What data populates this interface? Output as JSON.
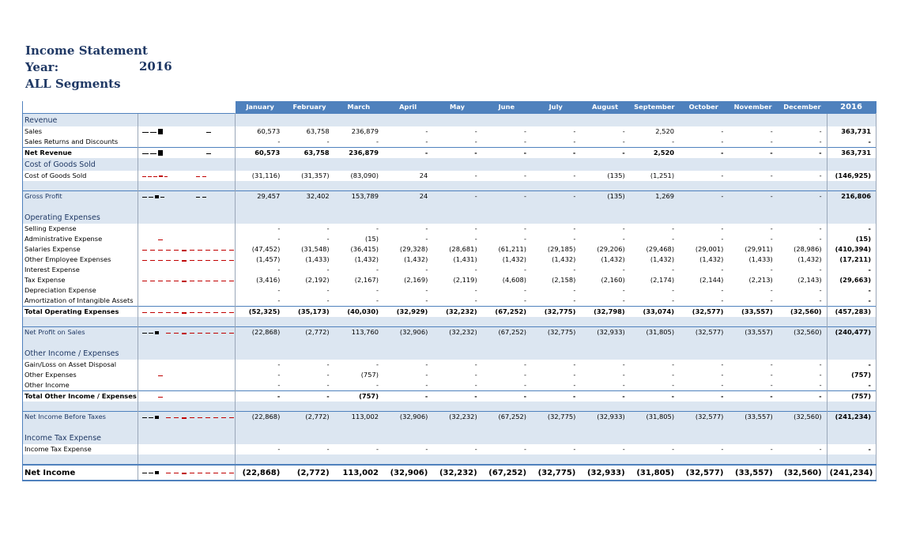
{
  "header": {
    "title": "Income Statement",
    "year_label": "Year:",
    "year_value": "2016",
    "segment": "ALL Segments"
  },
  "columns": [
    "January",
    "February",
    "March",
    "April",
    "May",
    "June",
    "July",
    "August",
    "September",
    "October",
    "November",
    "December",
    "2016"
  ],
  "rows": [
    {
      "type": "section",
      "label": "Revenue",
      "first": true
    },
    {
      "type": "line",
      "label": "Sales",
      "spark": "black",
      "values": [
        "60,573",
        "63,758",
        "236,879",
        "-",
        "-",
        "-",
        "-",
        "-",
        "2,520",
        "-",
        "-",
        "-",
        "363,731"
      ]
    },
    {
      "type": "line",
      "label": "Sales Returns and Discounts",
      "values": [
        "-",
        "-",
        "-",
        "-",
        "-",
        "-",
        "-",
        "-",
        "-",
        "-",
        "-",
        "-",
        "-"
      ]
    },
    {
      "type": "total",
      "label": "Net Revenue",
      "spark": "black",
      "values": [
        "60,573",
        "63,758",
        "236,879",
        "-",
        "-",
        "-",
        "-",
        "-",
        "2,520",
        "-",
        "-",
        "-",
        "363,731"
      ]
    },
    {
      "type": "section",
      "label": "Cost of Goods Sold"
    },
    {
      "type": "line",
      "label": "Cost of Goods Sold",
      "spark": "red",
      "values": [
        "(31,116)",
        "(31,357)",
        "(83,090)",
        "24",
        "-",
        "-",
        "-",
        "(135)",
        "(1,251)",
        "-",
        "-",
        "-",
        "(146,925)"
      ]
    },
    {
      "type": "spacer"
    },
    {
      "type": "shaded",
      "label": "Gross Profit",
      "spark": "mixed",
      "values": [
        "29,457",
        "32,402",
        "153,789",
        "24",
        "-",
        "-",
        "-",
        "(135)",
        "1,269",
        "-",
        "-",
        "-",
        "216,806"
      ]
    },
    {
      "type": "spacer"
    },
    {
      "type": "section",
      "label": "Operating Expenses"
    },
    {
      "type": "line",
      "label": "Selling Expense",
      "values": [
        "-",
        "-",
        "-",
        "-",
        "-",
        "-",
        "-",
        "-",
        "-",
        "-",
        "-",
        "-",
        "-"
      ]
    },
    {
      "type": "line",
      "label": "Administrative Expense",
      "spark": "reddot",
      "values": [
        "-",
        "-",
        "(15)",
        "-",
        "-",
        "-",
        "-",
        "-",
        "-",
        "-",
        "-",
        "-",
        "(15)"
      ]
    },
    {
      "type": "line",
      "label": "Salaries Expense",
      "spark": "redline",
      "values": [
        "(47,452)",
        "(31,548)",
        "(36,415)",
        "(29,328)",
        "(28,681)",
        "(61,211)",
        "(29,185)",
        "(29,206)",
        "(29,468)",
        "(29,001)",
        "(29,911)",
        "(28,986)",
        "(410,394)"
      ]
    },
    {
      "type": "line",
      "label": "Other Employee Expenses",
      "spark": "redline",
      "values": [
        "(1,457)",
        "(1,433)",
        "(1,432)",
        "(1,432)",
        "(1,431)",
        "(1,432)",
        "(1,432)",
        "(1,432)",
        "(1,432)",
        "(1,432)",
        "(1,433)",
        "(1,432)",
        "(17,211)"
      ]
    },
    {
      "type": "line",
      "label": "Interest Expense",
      "values": [
        "-",
        "-",
        "-",
        "-",
        "-",
        "-",
        "-",
        "-",
        "-",
        "-",
        "-",
        "-",
        "-"
      ]
    },
    {
      "type": "line",
      "label": "Tax Expense",
      "spark": "redline",
      "values": [
        "(3,416)",
        "(2,192)",
        "(2,167)",
        "(2,169)",
        "(2,119)",
        "(4,608)",
        "(2,158)",
        "(2,160)",
        "(2,174)",
        "(2,144)",
        "(2,213)",
        "(2,143)",
        "(29,663)"
      ]
    },
    {
      "type": "line",
      "label": "Depreciation Expense",
      "values": [
        "-",
        "-",
        "-",
        "-",
        "-",
        "-",
        "-",
        "-",
        "-",
        "-",
        "-",
        "-",
        "-"
      ]
    },
    {
      "type": "line",
      "label": "Amortization of Intangible Assets",
      "values": [
        "-",
        "-",
        "-",
        "-",
        "-",
        "-",
        "-",
        "-",
        "-",
        "-",
        "-",
        "-",
        "-"
      ]
    },
    {
      "type": "total",
      "label": "Total Operating Expenses",
      "spark": "redline",
      "values": [
        "(52,325)",
        "(35,173)",
        "(40,030)",
        "(32,929)",
        "(32,232)",
        "(67,252)",
        "(32,775)",
        "(32,798)",
        "(33,074)",
        "(32,577)",
        "(33,557)",
        "(32,560)",
        "(457,283)"
      ]
    },
    {
      "type": "spacer"
    },
    {
      "type": "shaded",
      "label": "Net Profit on Sales",
      "spark": "mixedline",
      "values": [
        "(22,868)",
        "(2,772)",
        "113,760",
        "(32,906)",
        "(32,232)",
        "(67,252)",
        "(32,775)",
        "(32,933)",
        "(31,805)",
        "(32,577)",
        "(33,557)",
        "(32,560)",
        "(240,477)"
      ]
    },
    {
      "type": "spacer"
    },
    {
      "type": "section",
      "label": "Other Income /  Expenses"
    },
    {
      "type": "line",
      "label": "Gain/Loss on Asset Disposal",
      "values": [
        "-",
        "-",
        "-",
        "-",
        "-",
        "-",
        "-",
        "-",
        "-",
        "-",
        "-",
        "-",
        "-"
      ]
    },
    {
      "type": "line",
      "label": "Other Expenses",
      "spark": "reddot",
      "values": [
        "-",
        "-",
        "(757)",
        "-",
        "-",
        "-",
        "-",
        "-",
        "-",
        "-",
        "-",
        "-",
        "(757)"
      ]
    },
    {
      "type": "line",
      "label": "Other Income",
      "values": [
        "-",
        "-",
        "-",
        "-",
        "-",
        "-",
        "-",
        "-",
        "-",
        "-",
        "-",
        "-",
        "-"
      ]
    },
    {
      "type": "total",
      "label": "Total Other Income / Expenses",
      "spark": "reddot",
      "values": [
        "-",
        "-",
        "(757)",
        "-",
        "-",
        "-",
        "-",
        "-",
        "-",
        "-",
        "-",
        "-",
        "(757)"
      ]
    },
    {
      "type": "spacer"
    },
    {
      "type": "shaded",
      "label": "Net Income Before Taxes",
      "spark": "mixedline",
      "values": [
        "(22,868)",
        "(2,772)",
        "113,002",
        "(32,906)",
        "(32,232)",
        "(67,252)",
        "(32,775)",
        "(32,933)",
        "(31,805)",
        "(32,577)",
        "(33,557)",
        "(32,560)",
        "(241,234)"
      ]
    },
    {
      "type": "spacer"
    },
    {
      "type": "section",
      "label": "Income Tax Expense"
    },
    {
      "type": "line",
      "label": "Income Tax Expense",
      "values": [
        "-",
        "-",
        "-",
        "-",
        "-",
        "-",
        "-",
        "-",
        "-",
        "-",
        "-",
        "-",
        "-"
      ]
    },
    {
      "type": "spacer"
    },
    {
      "type": "final",
      "label": "Net Income",
      "spark": "mixedline",
      "values": [
        "(22,868)",
        "(2,772)",
        "113,002",
        "(32,906)",
        "(32,232)",
        "(67,252)",
        "(32,775)",
        "(32,933)",
        "(31,805)",
        "(32,577)",
        "(33,557)",
        "(32,560)",
        "(241,234)"
      ]
    }
  ],
  "colors": {
    "accent": "#4f81bd",
    "section_bg": "#dce6f1",
    "title": "#1f3864",
    "negative_spark": "#c00000"
  }
}
